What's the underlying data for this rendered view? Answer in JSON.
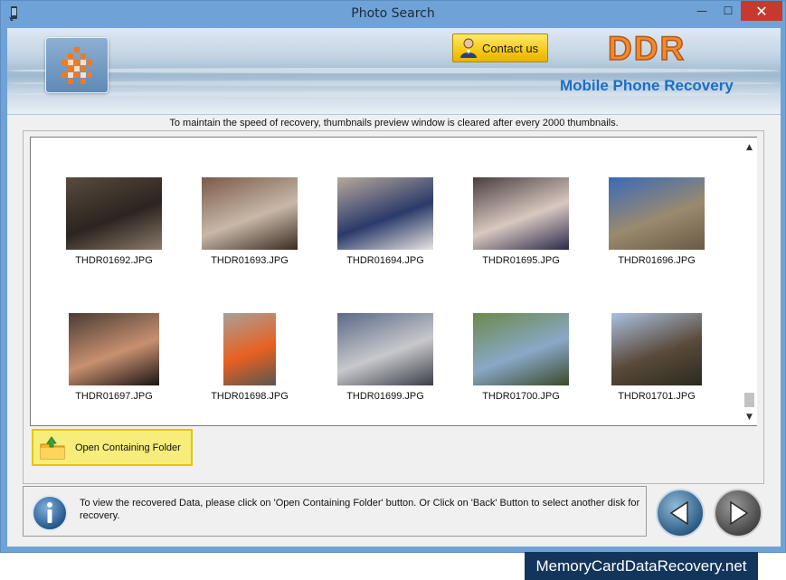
{
  "window": {
    "title": "Photo Search",
    "minimize_glyph": "—",
    "maximize_glyph": "☐",
    "close_glyph": "✕"
  },
  "banner": {
    "contact_label": "Contact us",
    "brand": "DDR",
    "product": "Mobile Phone Recovery"
  },
  "notice": "To maintain the speed of recovery, thumbnails preview window is cleared after every 2000 thumbnails.",
  "thumbnails": [
    {
      "name": "THDR01692.JPG",
      "colors": [
        "#5a4a3c",
        "#2b2420",
        "#8a7a6a"
      ]
    },
    {
      "name": "THDR01693.JPG",
      "colors": [
        "#7a5a48",
        "#c8b8a8",
        "#3a2a22"
      ]
    },
    {
      "name": "THDR01694.JPG",
      "colors": [
        "#b7a89a",
        "#2a3a6a",
        "#e8e4e0"
      ]
    },
    {
      "name": "THDR01695.JPG",
      "colors": [
        "#4a3e40",
        "#d8c8c0",
        "#2a2a4a"
      ]
    },
    {
      "name": "THDR01696.JPG",
      "colors": [
        "#3a6ab8",
        "#9a8a6e",
        "#6a5a46"
      ]
    },
    {
      "name": "THDR01697.JPG",
      "colors": [
        "#4a3c34",
        "#c89070",
        "#1a1412"
      ]
    },
    {
      "name": "THDR01698.JPG",
      "colors": [
        "#a8a098",
        "#e86020",
        "#5a5650"
      ]
    },
    {
      "name": "THDR01699.JPG",
      "colors": [
        "#5a6a86",
        "#c8c8cc",
        "#3a3e48"
      ]
    },
    {
      "name": "THDR01700.JPG",
      "colors": [
        "#6a8a4a",
        "#8aa8c8",
        "#3a4a2a"
      ]
    },
    {
      "name": "THDR01701.JPG",
      "colors": [
        "#aac0e0",
        "#5a4a3a",
        "#2a2a20"
      ]
    }
  ],
  "open_folder_label": "Open Containing Folder",
  "info_text": "To view the recovered Data, please click on 'Open Containing Folder' button. Or Click on 'Back' Button to select another disk for recovery.",
  "footer_brand": "MemoryCardDataRecovery.net",
  "icons": {
    "contact": "person-icon",
    "folder": "folder-up-icon",
    "info": "info-icon",
    "back": "back-arrow-icon",
    "next": "next-arrow-icon"
  },
  "colors": {
    "titlebar": "#6fa2d6",
    "close": "#c7392f",
    "brand_orange": "#f38a2a",
    "product_blue": "#1b6fc6",
    "highlight": "#f6ed7a",
    "footer": "#13355c"
  }
}
